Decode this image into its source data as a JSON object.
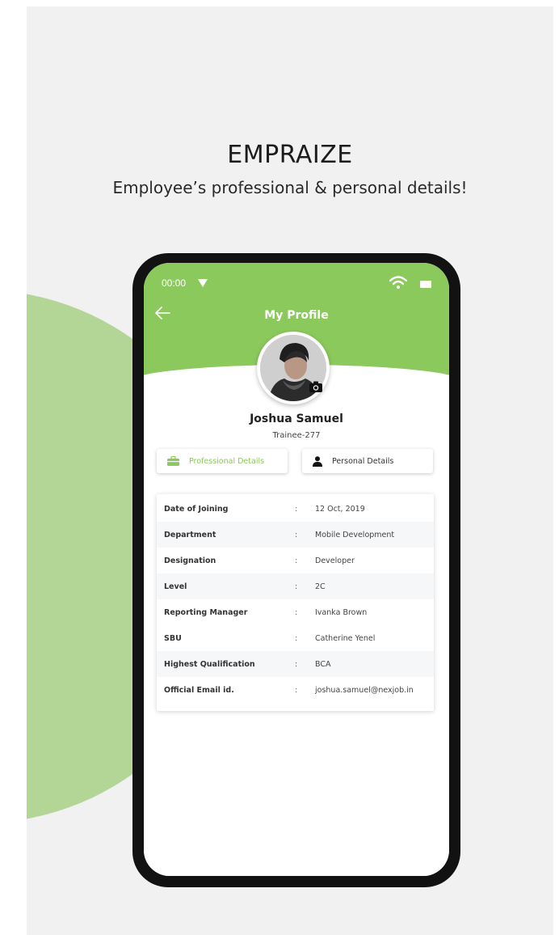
{
  "promo": {
    "title": "EMPRAIZE",
    "subtitle": "Employee’s professional & personal details!"
  },
  "colors": {
    "accent": "#8cc95c",
    "blob": "#b3d696",
    "background": "#f1f1f1"
  },
  "status_bar": {
    "time": "00:00",
    "icons": [
      "signal-icon",
      "wifi-icon",
      "battery-icon"
    ]
  },
  "header": {
    "title": "My Profile",
    "back_icon": "arrow-left-icon"
  },
  "profile": {
    "name": "Joshua Samuel",
    "employee_id": "Trainee-277",
    "avatar_icon": "profile-photo",
    "camera_icon": "camera-icon"
  },
  "tabs": [
    {
      "label": "Professional Details",
      "icon": "briefcase-icon",
      "selected": true
    },
    {
      "label": "Personal Details",
      "icon": "person-icon",
      "selected": false
    }
  ],
  "details": [
    {
      "label": "Date of Joining",
      "separator": ":",
      "value": "12 Oct, 2019"
    },
    {
      "label": "Department",
      "separator": ":",
      "value": "Mobile Development"
    },
    {
      "label": "Designation",
      "separator": ":",
      "value": "Developer"
    },
    {
      "label": "Level",
      "separator": ":",
      "value": "2C"
    },
    {
      "label": "Reporting Manager",
      "separator": ":",
      "value": "Ivanka Brown"
    },
    {
      "label": "SBU",
      "separator": ":",
      "value": "Catherine Yenel"
    },
    {
      "label": "Highest Qualification",
      "separator": ":",
      "value": "BCA"
    },
    {
      "label": "Official Email id.",
      "separator": ":",
      "value": "joshua.samuel@nexjob.in"
    }
  ]
}
